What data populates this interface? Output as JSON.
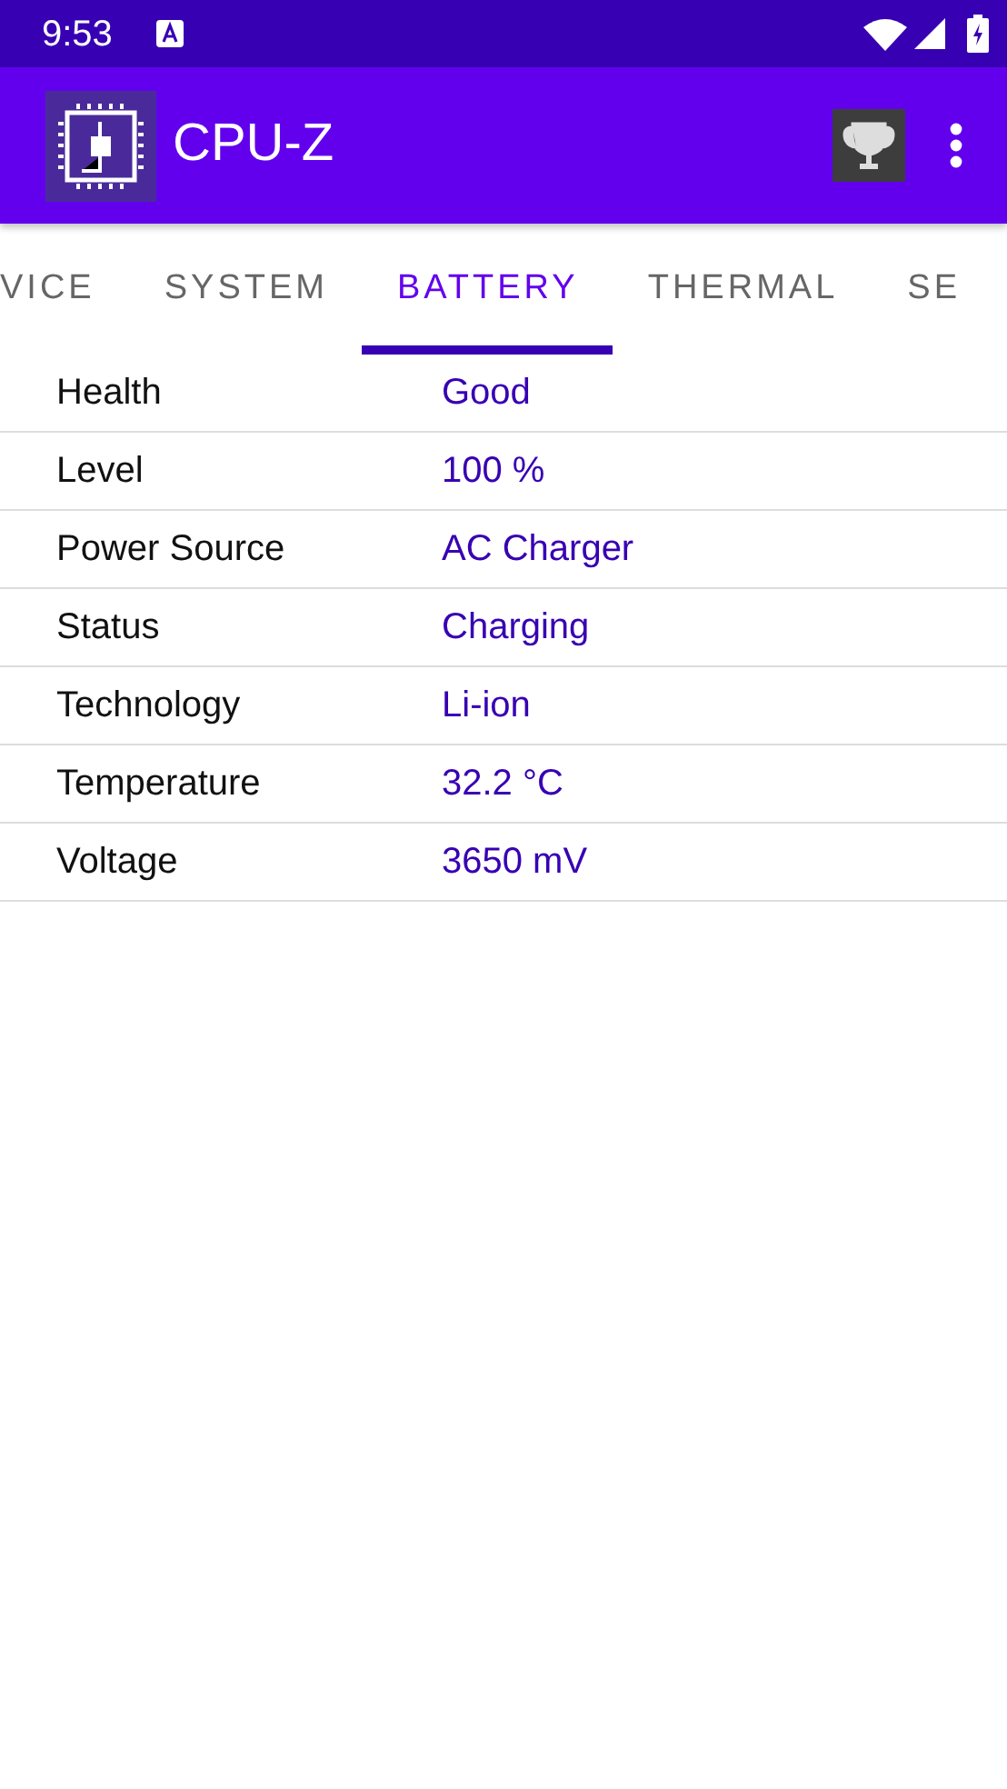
{
  "status_bar": {
    "time": "9:53"
  },
  "app_bar": {
    "title": "CPU-Z"
  },
  "tabs": [
    {
      "label": "VICE",
      "selected": false
    },
    {
      "label": "SYSTEM",
      "selected": false
    },
    {
      "label": "BATTERY",
      "selected": true
    },
    {
      "label": "THERMAL",
      "selected": false
    },
    {
      "label": "SE",
      "selected": false
    }
  ],
  "rows": [
    {
      "label": "Health",
      "value": "Good"
    },
    {
      "label": "Level",
      "value": "100 %"
    },
    {
      "label": "Power Source",
      "value": "AC Charger"
    },
    {
      "label": "Status",
      "value": "Charging"
    },
    {
      "label": "Technology",
      "value": "Li-ion"
    },
    {
      "label": "Temperature",
      "value": "32.2 °C"
    },
    {
      "label": "Voltage",
      "value": "3650 mV"
    }
  ]
}
